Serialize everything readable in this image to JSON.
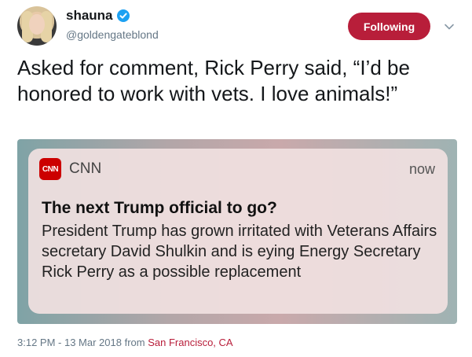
{
  "user": {
    "display_name": "shauna",
    "handle": "@goldengateblond",
    "verified": true
  },
  "follow_button": {
    "label": "Following",
    "color": "#b81e3a"
  },
  "tweet": {
    "text": "Asked for comment, Rick Perry said, “I’d be honored to work with vets. I love animals!”"
  },
  "notification": {
    "app_logo_text": "CNN",
    "app_name": "CNN",
    "time": "now",
    "title": "The next Trump official to go?",
    "body": "President Trump has grown irritated with Veterans Affairs secretary David Shulkin and is eying Energy Secretary Rick Perry as a possible replacement"
  },
  "meta": {
    "timestamp": "3:12 PM - 13 Mar 2018",
    "from_label": "from",
    "location": "San Francisco, CA"
  },
  "icons": {
    "verified": "verified-badge-icon",
    "more": "chevron-down-icon"
  }
}
